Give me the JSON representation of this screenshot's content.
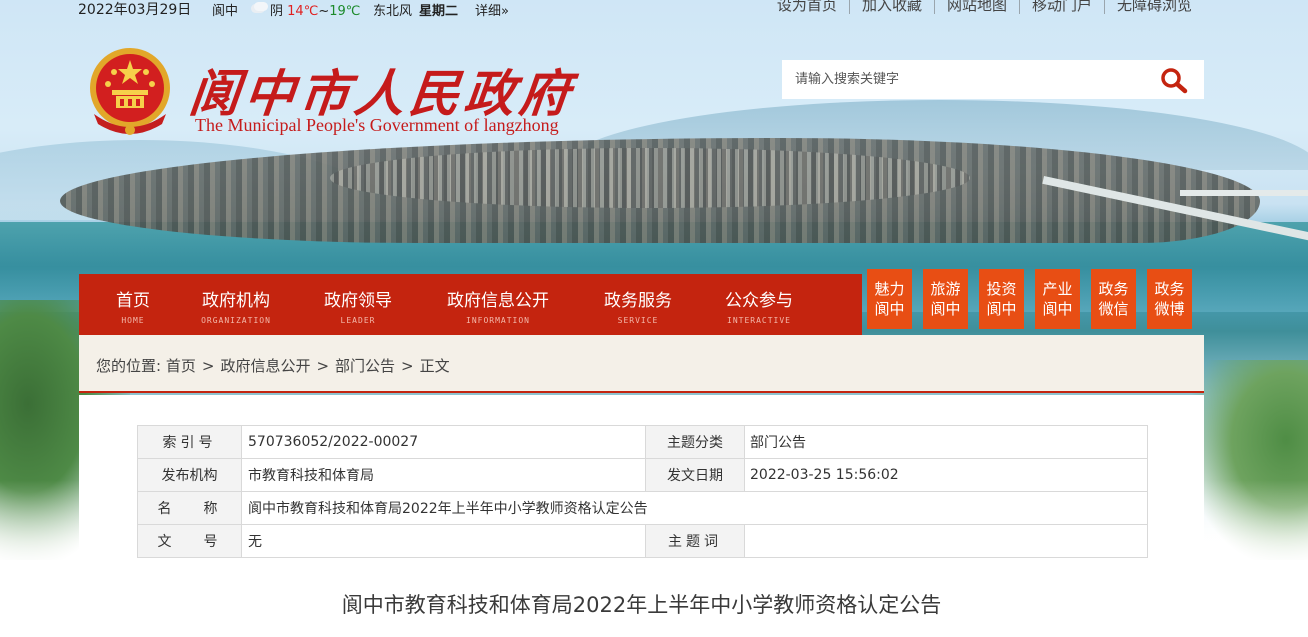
{
  "topbar": {
    "date": "2022年03月29日",
    "location": "阆中",
    "weather_icon": "cloud-icon",
    "weather_desc": "阴",
    "temp_high": "14℃",
    "temp_sep": "~",
    "temp_low": "19℃",
    "wind": "东北风",
    "weekday": "星期二",
    "detail": "详细»",
    "links": [
      "设为首页",
      "加入收藏",
      "网站地图",
      "移动门户",
      "无障碍浏览"
    ]
  },
  "logo": {
    "cn": "阆中市人民政府",
    "en": "The Municipal People's Government of langzhong"
  },
  "search": {
    "placeholder": "请输入搜索关键字",
    "icon": "search-icon"
  },
  "nav": [
    {
      "cn": "首页",
      "en": "HOME"
    },
    {
      "cn": "政府机构",
      "en": "ORGANIZATION"
    },
    {
      "cn": "政府领导",
      "en": "LEADER"
    },
    {
      "cn": "政府信息公开",
      "en": "INFORMATION"
    },
    {
      "cn": "政务服务",
      "en": "SERVICE"
    },
    {
      "cn": "公众参与",
      "en": "INTERACTIVE"
    }
  ],
  "quick_links": [
    [
      "魅力",
      "阆中"
    ],
    [
      "旅游",
      "阆中"
    ],
    [
      "投资",
      "阆中"
    ],
    [
      "产业",
      "阆中"
    ],
    [
      "政务",
      "微信"
    ],
    [
      "政务",
      "微博"
    ]
  ],
  "breadcrumb": {
    "prefix": "您的位置:",
    "items": [
      "首页",
      "政府信息公开",
      "部门公告",
      "正文"
    ],
    "sep": ">"
  },
  "meta": {
    "index_label": "索引号",
    "index_value": "570736052/2022-00027",
    "topic_label": "主题分类",
    "topic_value": "部门公告",
    "publisher_label": "发布机构",
    "publisher_value": "市教育科技和体育局",
    "date_label": "发文日期",
    "date_value": "2022-03-25 15:56:02",
    "name_label": "名称",
    "name_value": "阆中市教育科技和体育局2022年上半年中小学教师资格认定公告",
    "docno_label": "文号",
    "docno_value": "无",
    "keywords_label": "主题词",
    "keywords_value": ""
  },
  "article": {
    "title": "阆中市教育科技和体育局2022年上半年中小学教师资格认定公告"
  },
  "colors": {
    "nav_red": "#c4240f",
    "quick_orange": "#e84e14",
    "logo_red": "#c51b1b"
  }
}
